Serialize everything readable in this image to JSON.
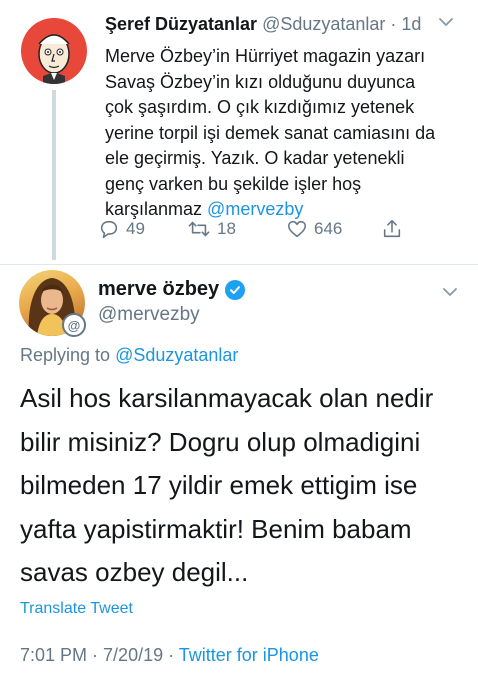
{
  "tweet1": {
    "display_name": "Şeref Düzyatanlar",
    "handle": "@Sduzyatanlar",
    "separator": " · ",
    "time": "1d",
    "text": "Merve Özbey’in Hürriyet magazin yazarı\nSavaş Özbey’in kızı olduğunu duyunca\nçok şaşırdım. O çık kızdığımız yetenek\nyerine torpil işi demek sanat camiasını da\nele geçirmiş. Yazık. O kadar yetenekli\ngenç varken bu şekilde işler hoş\nkarşılanmaz ",
    "mention": "@mervezby",
    "replies": "49",
    "retweets": "18",
    "likes": "646",
    "caret_icon": "chevron-down-icon"
  },
  "tweet2": {
    "display_name": "merve özbey",
    "handle": "@mervezby",
    "replying_prefix": "Replying to ",
    "replying_to": "@Sduzyatanlar",
    "text": "Asil hos karsilanmayacak olan nedir\nbilir misiniz? Dogru olup olmadigini\nbilmeden 17 yildir emek ettigim ise\nyafta yapistirmaktir! Benim babam\nsavas ozbey degil...",
    "translate": "Translate Tweet",
    "time": "7:01 PM",
    "date": "7/20/19",
    "dot": " · ",
    "source": "Twitter for iPhone"
  },
  "colors": {
    "link": "#1b95e0",
    "secondary": "#657786",
    "verified": "#1da1f2",
    "avatar1_bg": "#e8483a"
  }
}
